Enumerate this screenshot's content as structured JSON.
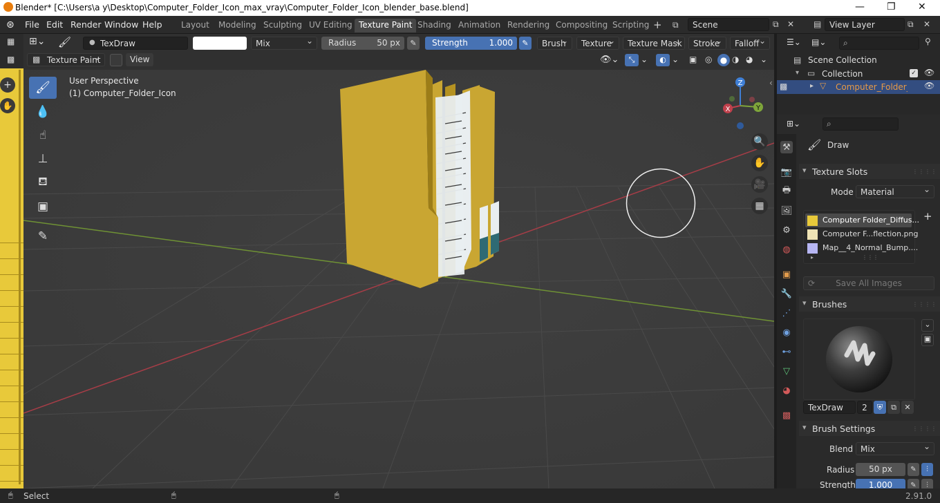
{
  "window": {
    "title": "Blender* [C:\\Users\\a y\\Desktop\\Computer_Folder_Icon_max_vray\\Computer_Folder_Icon_blender_base.blend]"
  },
  "menus": [
    "File",
    "Edit",
    "Render",
    "Window",
    "Help"
  ],
  "workspace_tabs": [
    "Layout",
    "Modeling",
    "Sculpting",
    "UV Editing",
    "Texture Paint",
    "Shading",
    "Animation",
    "Rendering",
    "Compositing",
    "Scripting"
  ],
  "active_workspace": "Texture Paint",
  "scene": {
    "name": "Scene"
  },
  "view_layer": {
    "name": "View Layer"
  },
  "tool_header": {
    "brush_name": "TexDraw",
    "blend": "Mix",
    "radius_label": "Radius",
    "radius_value": "50 px",
    "strength_label": "Strength",
    "strength_value": "1.000",
    "strength_fill": 1.0,
    "menus": [
      "Brush",
      "Texture",
      "Texture Mask",
      "Stroke",
      "Falloff"
    ]
  },
  "viewport_header": {
    "mode": "Texture Paint",
    "view_menu": "View"
  },
  "viewport": {
    "perspective": "User Perspective",
    "object_label": "(1) Computer_Folder_Icon",
    "gizmo_axes": [
      "Z",
      "Y",
      "X"
    ]
  },
  "outliner": {
    "root": "Scene Collection",
    "collection": "Collection",
    "object": "Computer_Folder_Ico"
  },
  "properties": {
    "tool_name": "Draw",
    "texture_slots_title": "Texture Slots",
    "mode_label": "Mode",
    "mode_value": "Material",
    "slots": [
      {
        "name": "Computer Folder_Diffus...",
        "color": "#e8c93a"
      },
      {
        "name": "Computer F...flection.png",
        "color": "#efe3b5"
      },
      {
        "name": "Map__4_Normal_Bump....",
        "color": "#b7b6f3"
      }
    ],
    "save_all": "Save All Images",
    "brushes_title": "Brushes",
    "brush_name": "TexDraw",
    "brush_users": "2",
    "brush_settings_title": "Brush Settings",
    "blend_label": "Blend",
    "blend_value": "Mix",
    "radius_label": "Radius",
    "radius_value": "50 px",
    "strength_label": "Strength",
    "strength_value": "1.000"
  },
  "statusbar": {
    "left": "Select",
    "version": "2.91.0"
  },
  "colors": {
    "accent": "#4772b3",
    "folder": "#c9a632",
    "x_axis": "#c0404c",
    "y_axis": "#7ea53a"
  }
}
